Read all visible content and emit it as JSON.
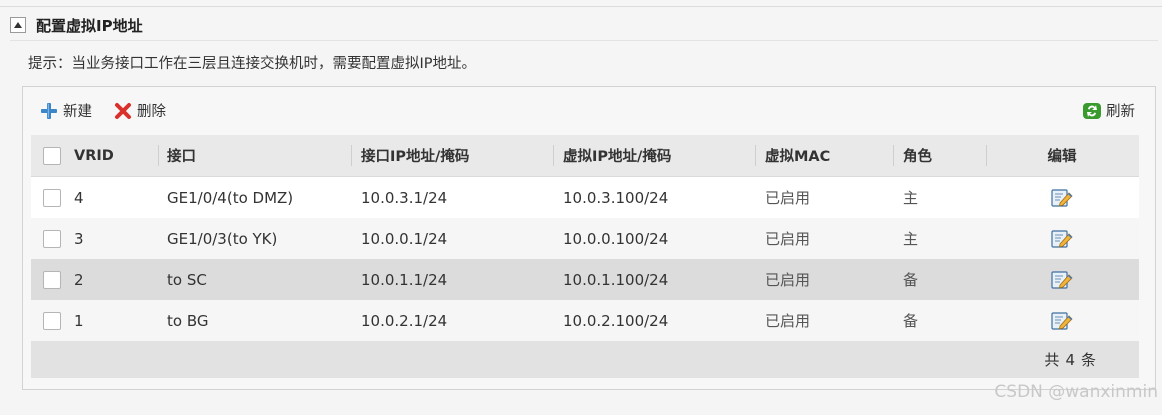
{
  "section": {
    "title": "配置虚拟IP地址",
    "hint": "提示：当业务接口工作在三层且连接交换机时，需要配置虚拟IP地址。"
  },
  "toolbar": {
    "new_label": "新建",
    "delete_label": "删除",
    "refresh_label": "刷新"
  },
  "table": {
    "columns": [
      "VRID",
      "接口",
      "接口IP地址/掩码",
      "虚拟IP地址/掩码",
      "虚拟MAC",
      "角色",
      "编辑"
    ],
    "rows": [
      {
        "vrid": "4",
        "interface": "GE1/0/4(to DMZ)",
        "ip": "10.0.3.1/24",
        "vip": "10.0.3.100/24",
        "mac": "已启用",
        "role": "主"
      },
      {
        "vrid": "3",
        "interface": "GE1/0/3(to YK)",
        "ip": "10.0.0.1/24",
        "vip": "10.0.0.100/24",
        "mac": "已启用",
        "role": "主"
      },
      {
        "vrid": "2",
        "interface": "to SC",
        "ip": "10.0.1.1/24",
        "vip": "10.0.1.100/24",
        "mac": "已启用",
        "role": "备"
      },
      {
        "vrid": "1",
        "interface": "to BG",
        "ip": "10.0.2.1/24",
        "vip": "10.0.2.100/24",
        "mac": "已启用",
        "role": "备"
      }
    ],
    "footer": {
      "prefix": "共",
      "count": "4",
      "suffix": "条"
    }
  },
  "watermark": "CSDN @wanxinmin",
  "colors": {
    "new_icon": "#3a86c8",
    "delete_icon": "#d9302c",
    "refresh_icon": "#3a9a2e",
    "selected_row": "#dcdcdc"
  }
}
